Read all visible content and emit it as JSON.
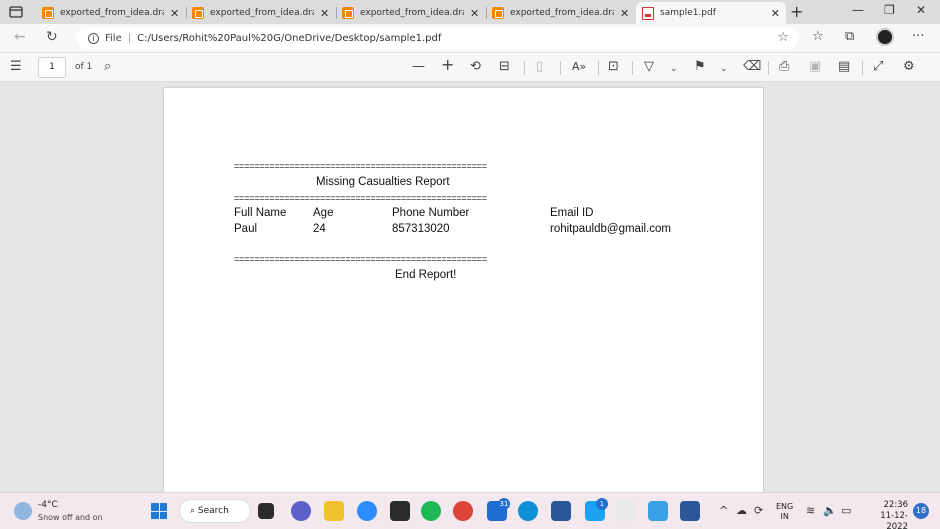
{
  "browser": {
    "tabs": [
      {
        "title": "exported_from_idea.drawio",
        "active": false
      },
      {
        "title": "exported_from_idea.drawio",
        "active": false
      },
      {
        "title": "exported_from_idea.drawio",
        "active": false
      },
      {
        "title": "exported_from_idea.drawio",
        "active": false
      },
      {
        "title": "sample1.pdf",
        "active": true
      }
    ],
    "address": {
      "scheme_label": "File",
      "url": "C:/Users/Rohit%20Paul%20G/OneDrive/Desktop/sample1.pdf"
    }
  },
  "pdf_toolbar": {
    "page_number": "1",
    "page_count_label": "of 1"
  },
  "document": {
    "rule": "==================================================",
    "title": "Missing Casualties Report",
    "columns": [
      "Full Name",
      "Age",
      "Phone Number",
      "Email ID"
    ],
    "rows": [
      [
        "Paul",
        "24",
        "857313020",
        "rohitpauldb@gmail.com"
      ]
    ],
    "footer": "End Report!"
  },
  "taskbar": {
    "weather_temp": "-4°C",
    "weather_desc": "Snow off and on",
    "search_label": "Search",
    "mail_badge": "31",
    "twitter_badge": "1",
    "lang_primary": "ENG",
    "lang_secondary": "IN",
    "time": "22:36",
    "date": "11-12-2022",
    "notification_count": "18"
  },
  "colors": {
    "tab_strip": "#dcdcdc",
    "toolbar": "#f7f7f7",
    "viewer_bg": "#e6e6e6",
    "taskbar": "#f3e8ee",
    "accent": "#1f6fd0",
    "drawio_orange": "#f08705"
  }
}
